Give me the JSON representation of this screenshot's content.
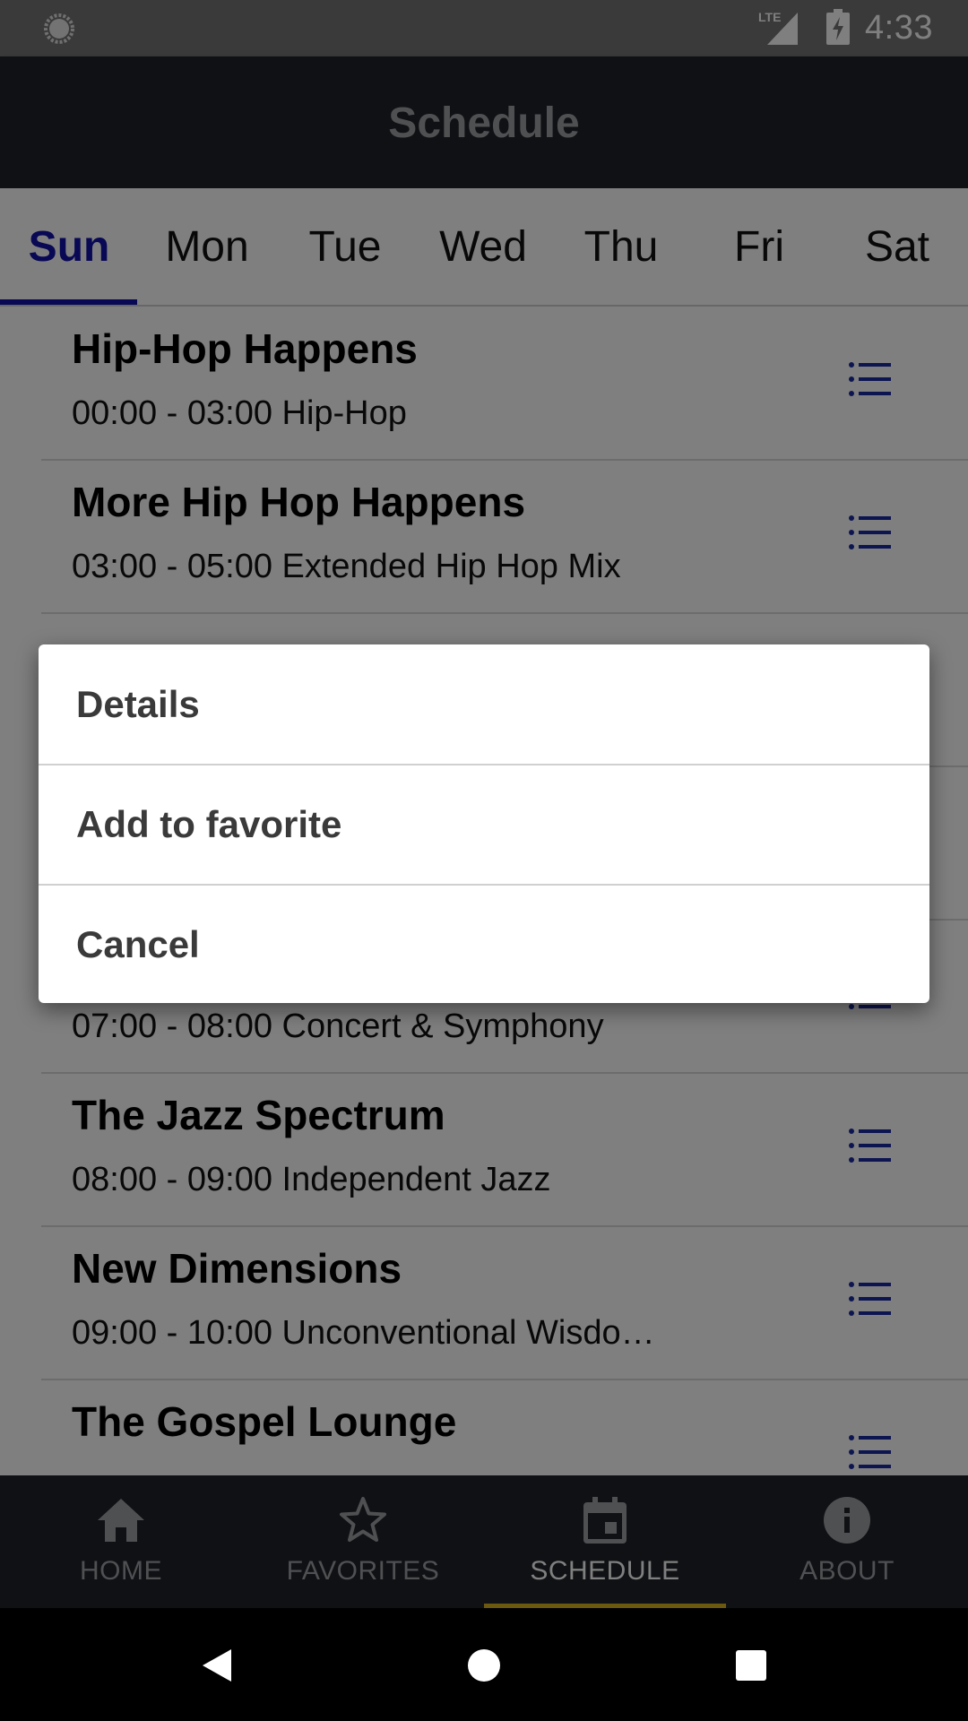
{
  "status_bar": {
    "time": "4:33",
    "network": "LTE"
  },
  "app_bar": {
    "title": "Schedule"
  },
  "day_tabs": [
    {
      "label": "Sun",
      "active": true
    },
    {
      "label": "Mon",
      "active": false
    },
    {
      "label": "Tue",
      "active": false
    },
    {
      "label": "Wed",
      "active": false
    },
    {
      "label": "Thu",
      "active": false
    },
    {
      "label": "Fri",
      "active": false
    },
    {
      "label": "Sat",
      "active": false
    }
  ],
  "schedule": [
    {
      "title": "Hip-Hop Happens",
      "subtitle": "00:00 - 03:00 Hip-Hop"
    },
    {
      "title": "More Hip Hop Happens",
      "subtitle": "03:00 - 05:00 Extended Hip Hop Mix"
    },
    {
      "title": "",
      "subtitle": ""
    },
    {
      "title": "",
      "subtitle": ""
    },
    {
      "title": "",
      "subtitle": "07:00 - 08:00 Concert & Symphony"
    },
    {
      "title": "The Jazz Spectrum",
      "subtitle": "08:00 - 09:00 Independent Jazz"
    },
    {
      "title": "New Dimensions",
      "subtitle": "09:00 - 10:00 Unconventional Wisdo…"
    },
    {
      "title": "The Gospel Lounge",
      "subtitle": ""
    }
  ],
  "row_icon": "list-icon",
  "context_menu": {
    "items": [
      {
        "label": "Details"
      },
      {
        "label": "Add to favorite"
      },
      {
        "label": "Cancel"
      }
    ]
  },
  "bottom_nav": [
    {
      "label": "HOME",
      "icon": "home-icon",
      "active": false
    },
    {
      "label": "FAVORITES",
      "icon": "star-icon",
      "active": false
    },
    {
      "label": "SCHEDULE",
      "icon": "calendar-icon",
      "active": true
    },
    {
      "label": "ABOUT",
      "icon": "info-icon",
      "active": false
    }
  ],
  "colors": {
    "app_bar": "#1f2229",
    "active_tab": "#1111a8",
    "nav_indicator": "#d4b21e",
    "list_icon": "#1b2aa3"
  }
}
